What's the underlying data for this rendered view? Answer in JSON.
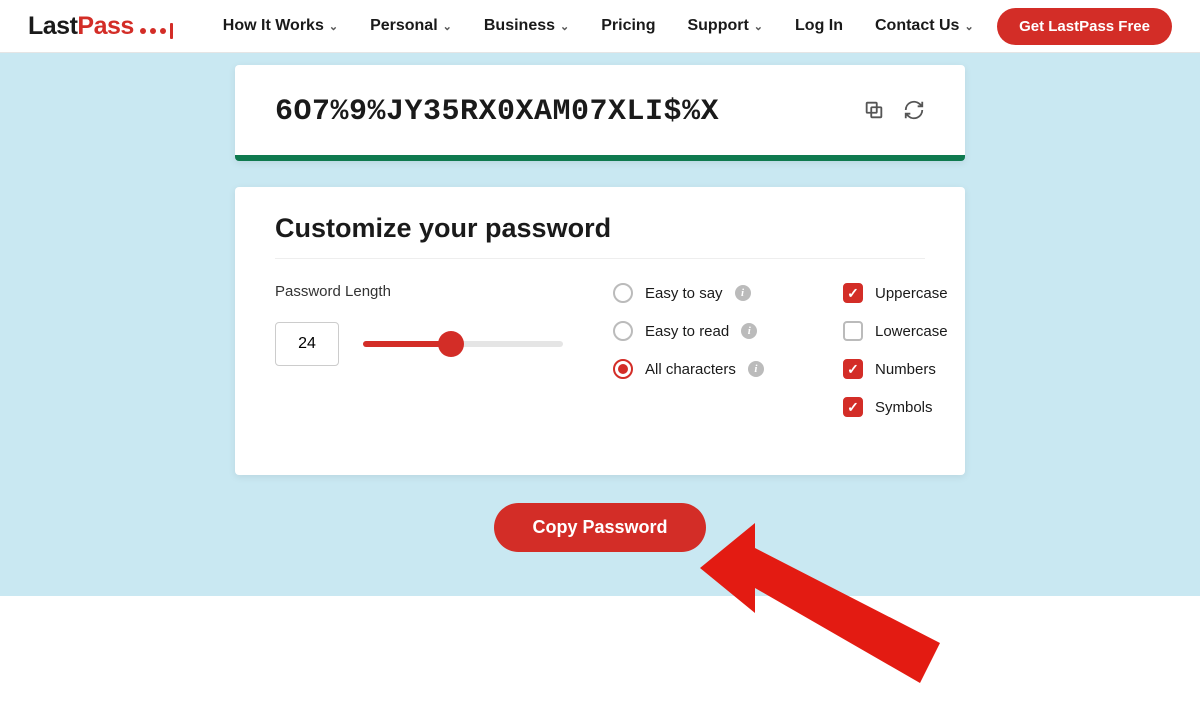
{
  "brand": {
    "part1": "Last",
    "part2": "Pass"
  },
  "nav": {
    "how": "How It Works",
    "personal": "Personal",
    "business": "Business",
    "pricing": "Pricing",
    "support": "Support",
    "login": "Log In",
    "contact": "Contact Us"
  },
  "cta": "Get LastPass Free",
  "password": "6O7%9%JY35RX0XAM07XLI$%X",
  "options": {
    "title": "Customize your password",
    "length_label": "Password Length",
    "length_value": "24",
    "radios": {
      "easy_say": "Easy to say",
      "easy_read": "Easy to read",
      "all_chars": "All characters",
      "selected": "all_chars"
    },
    "checks": {
      "uppercase": {
        "label": "Uppercase",
        "checked": true
      },
      "lowercase": {
        "label": "Lowercase",
        "checked": false
      },
      "numbers": {
        "label": "Numbers",
        "checked": true
      },
      "symbols": {
        "label": "Symbols",
        "checked": true
      }
    }
  },
  "copy_button": "Copy Password",
  "colors": {
    "brand_red": "#d32d27",
    "strength_green": "#0f7a4f",
    "stage_blue": "#c9e8f2"
  }
}
